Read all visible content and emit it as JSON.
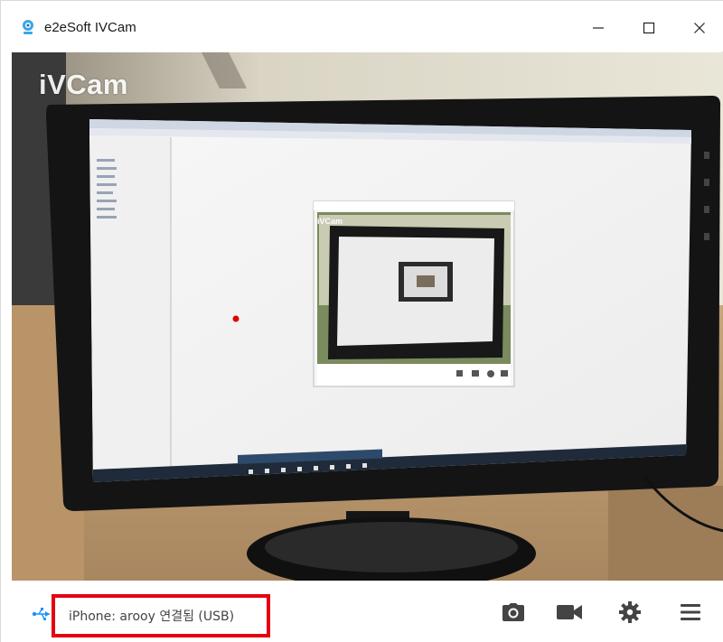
{
  "window": {
    "title": "e2eSoft IVCam"
  },
  "video": {
    "watermark": "iVCam",
    "inner_watermark": "iVCam"
  },
  "statusbar": {
    "connection_text": "iPhone: arooy 연결됨 (USB)",
    "highlight_color": "#e50012"
  },
  "icons": {
    "app": "webcam-icon",
    "usb": "usb-icon",
    "snapshot": "camera-icon",
    "record": "video-camera-icon",
    "settings": "gear-icon",
    "menu": "hamburger-menu-icon"
  },
  "colors": {
    "accent": "#1e90ff",
    "icon": "#444444",
    "highlight": "#e50012"
  }
}
